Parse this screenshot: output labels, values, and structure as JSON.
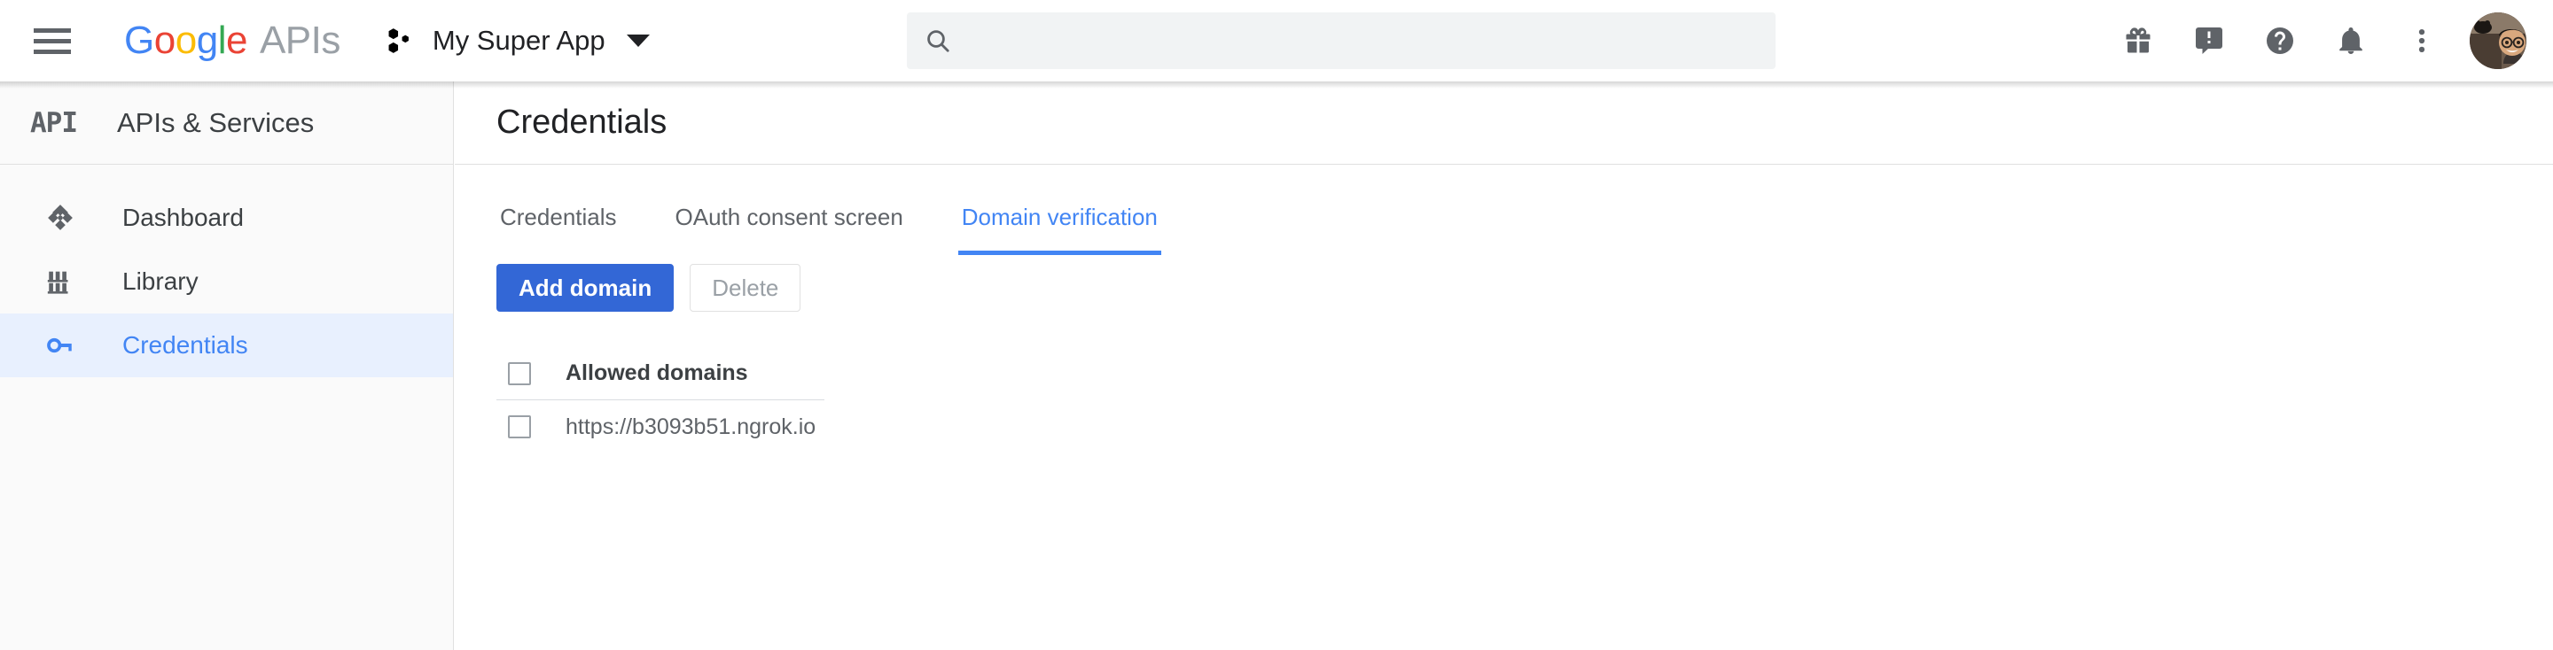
{
  "header": {
    "menu_icon": "hamburger-menu-icon",
    "brand": {
      "g1": "G",
      "g2": "o",
      "g3": "o",
      "g4": "g",
      "g5": "l",
      "g6": "e",
      "suffix": "APIs"
    },
    "project": {
      "icon": "project-hexagons-icon",
      "name": "My Super App",
      "caret_icon": "chevron-down-icon"
    },
    "search": {
      "icon": "search-icon",
      "value": "",
      "placeholder": ""
    },
    "right_icons": [
      {
        "name": "gift-icon",
        "label": "Gifts"
      },
      {
        "name": "feedback-icon",
        "label": "Send feedback"
      },
      {
        "name": "help-icon",
        "label": "Help"
      },
      {
        "name": "notifications-bell-icon",
        "label": "Notifications"
      },
      {
        "name": "more-options-icon",
        "label": "More options"
      }
    ],
    "avatar": {
      "name": "user-avatar",
      "label": "Account"
    }
  },
  "sidebar": {
    "logo_text": "API",
    "title": "APIs & Services",
    "items": [
      {
        "label": "Dashboard",
        "icon": "dashboard-diamond-icon",
        "active": false
      },
      {
        "label": "Library",
        "icon": "library-books-icon",
        "active": false
      },
      {
        "label": "Credentials",
        "icon": "key-icon",
        "active": true
      }
    ]
  },
  "main": {
    "page_title": "Credentials",
    "tabs": [
      {
        "label": "Credentials",
        "active": false
      },
      {
        "label": "OAuth consent screen",
        "active": false
      },
      {
        "label": "Domain verification",
        "active": true
      }
    ],
    "buttons": {
      "add_domain": "Add domain",
      "delete": "Delete"
    },
    "table": {
      "header": "Allowed domains",
      "rows": [
        {
          "domain": "https://b3093b51.ngrok.io"
        }
      ]
    }
  },
  "colors": {
    "accent_blue": "#4285f4",
    "button_blue": "#3367d6",
    "active_nav_bg": "#e8f0fe",
    "sidebar_bg": "#fafafa",
    "search_bg": "#f1f3f4",
    "text_primary": "#202124",
    "text_secondary": "#5f6368",
    "border": "#e0e0e0"
  }
}
